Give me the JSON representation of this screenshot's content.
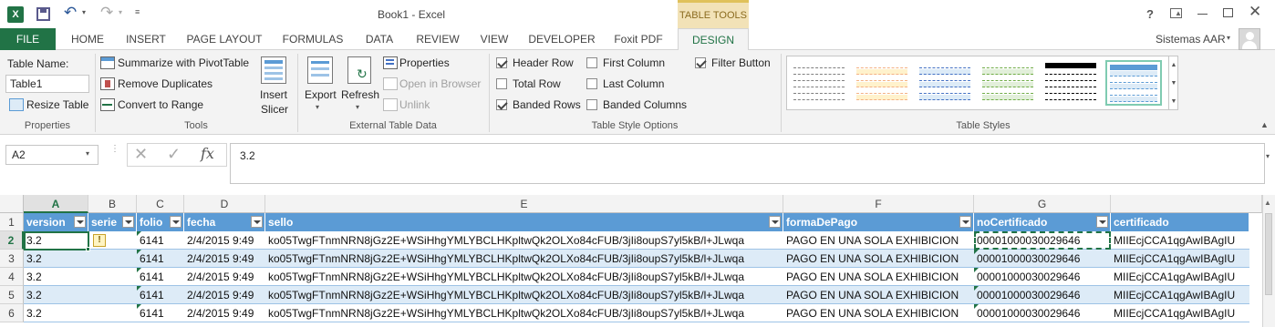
{
  "window": {
    "title": "Book1 - Excel",
    "contextual_tab_group": "TABLE TOOLS",
    "help": "?",
    "user": "Sistemas AAR"
  },
  "tabs": [
    "FILE",
    "HOME",
    "INSERT",
    "PAGE LAYOUT",
    "FORMULAS",
    "DATA",
    "REVIEW",
    "VIEW",
    "DEVELOPER",
    "Foxit PDF",
    "DESIGN"
  ],
  "ribbon": {
    "properties": {
      "table_name_label": "Table Name:",
      "table_name_value": "Table1",
      "resize_table": "Resize Table",
      "group_label": "Properties"
    },
    "tools": {
      "summarize": "Summarize with PivotTable",
      "remove_duplicates": "Remove Duplicates",
      "convert_to_range": "Convert to Range",
      "insert_slicer_1": "Insert",
      "insert_slicer_2": "Slicer",
      "group_label": "Tools"
    },
    "external": {
      "export": "Export",
      "refresh": "Refresh",
      "properties": "Properties",
      "open_in_browser": "Open in Browser",
      "unlink": "Unlink",
      "group_label": "External Table Data"
    },
    "style_options": {
      "header_row": "Header Row",
      "total_row": "Total Row",
      "banded_rows": "Banded Rows",
      "first_column": "First Column",
      "last_column": "Last Column",
      "banded_columns": "Banded Columns",
      "filter_button": "Filter Button",
      "group_label": "Table Style Options",
      "checked": {
        "header_row": true,
        "total_row": false,
        "banded_rows": true,
        "first_column": false,
        "last_column": false,
        "banded_columns": false,
        "filter_button": true
      }
    },
    "table_styles": {
      "group_label": "Table Styles",
      "swatches": [
        {
          "header": "#ffffff",
          "line": "#7f7f7f",
          "band": "#ffffff"
        },
        {
          "header": "#ffffff",
          "line": "#f4b183",
          "band": "#fff2cc"
        },
        {
          "header": "#ffffff",
          "line": "#4472c4",
          "band": "#ddebf7"
        },
        {
          "header": "#ffffff",
          "line": "#70ad47",
          "band": "#e2efda"
        },
        {
          "header": "#000000",
          "line": "#000000",
          "band": "#ffffff"
        },
        {
          "header": "#5b9bd5",
          "line": "#5b9bd5",
          "band": "#ddebf7"
        }
      ]
    }
  },
  "formula_bar": {
    "name_box": "A2",
    "fx": "fx",
    "content": "3.2"
  },
  "grid": {
    "columns": [
      "A",
      "B",
      "C",
      "D",
      "E",
      "F",
      "G"
    ],
    "headers": [
      "version",
      "serie",
      "folio",
      "fecha",
      "sello",
      "formaDePago",
      "noCertificado",
      "certificado"
    ],
    "row_numbers": [
      "1",
      "2",
      "3",
      "4",
      "5",
      "6"
    ],
    "rows": [
      [
        "3.2",
        "",
        "6141",
        "2/4/2015 9:49",
        "ko05TwgFTnmNRN8jGz2E+WSiHhgYMLYBCLHKpltwQk2OLXo84cFUB/3jIi8oupS7yl5kB/l+JLwqa",
        "PAGO EN UNA SOLA EXHIBICION",
        "00001000030029646",
        "MIIEcjCCA1qgAwIBAgIU"
      ],
      [
        "3.2",
        "",
        "6141",
        "2/4/2015 9:49",
        "ko05TwgFTnmNRN8jGz2E+WSiHhgYMLYBCLHKpltwQk2OLXo84cFUB/3jIi8oupS7yl5kB/l+JLwqa",
        "PAGO EN UNA SOLA EXHIBICION",
        "00001000030029646",
        "MIIEcjCCA1qgAwIBAgIU"
      ],
      [
        "3.2",
        "",
        "6141",
        "2/4/2015 9:49",
        "ko05TwgFTnmNRN8jGz2E+WSiHhgYMLYBCLHKpltwQk2OLXo84cFUB/3jIi8oupS7yl5kB/l+JLwqa",
        "PAGO EN UNA SOLA EXHIBICION",
        "00001000030029646",
        "MIIEcjCCA1qgAwIBAgIU"
      ],
      [
        "3.2",
        "",
        "6141",
        "2/4/2015 9:49",
        "ko05TwgFTnmNRN8jGz2E+WSiHhgYMLYBCLHKpltwQk2OLXo84cFUB/3jIi8oupS7yl5kB/l+JLwqa",
        "PAGO EN UNA SOLA EXHIBICION",
        "00001000030029646",
        "MIIEcjCCA1qgAwIBAgIU"
      ],
      [
        "3.2",
        "",
        "6141",
        "2/4/2015 9:49",
        "ko05TwgFTnmNRN8jGz2E+WSiHhgYMLYBCLHKpltwQk2OLXo84cFUB/3jIi8oupS7yl5kB/l+JLwqa",
        "PAGO EN UNA SOLA EXHIBICION",
        "00001000030029646",
        "MIIEcjCCA1qgAwIBAgIU"
      ]
    ]
  },
  "colors": {
    "accent": "#217346",
    "table_header": "#5b9bd5",
    "band": "#ddebf7"
  }
}
